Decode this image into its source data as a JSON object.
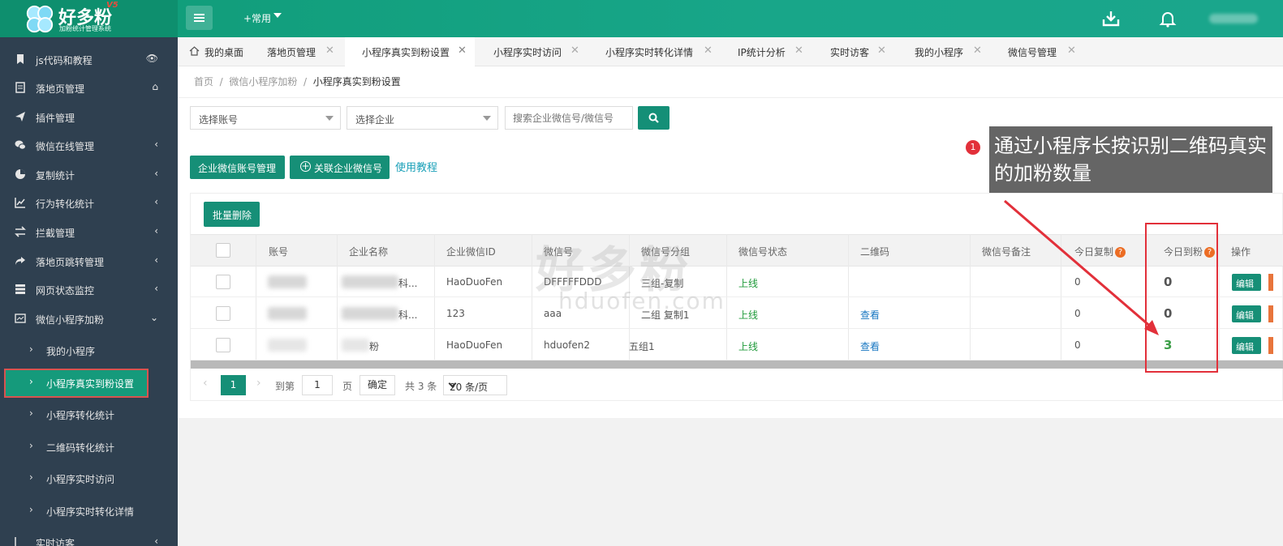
{
  "brand": {
    "name": "好多粉",
    "version": "V5",
    "subtitle": "加粉统计管理系统"
  },
  "topbar": {
    "common_label": "+常用"
  },
  "sidebar": {
    "items": [
      {
        "label": "js代码和教程",
        "icon": "bookmark-icon",
        "right": "👁"
      },
      {
        "label": "落地页管理",
        "icon": "file-icon",
        "right": "⌂"
      },
      {
        "label": "插件管理",
        "icon": "paper-plane-icon",
        "right": ""
      },
      {
        "label": "微信在线管理",
        "icon": "wechat-icon",
        "right": "‹"
      },
      {
        "label": "复制统计",
        "icon": "pie-chart-icon",
        "right": "‹"
      },
      {
        "label": "行为转化统计",
        "icon": "line-chart-icon",
        "right": "‹"
      },
      {
        "label": "拦截管理",
        "icon": "exchange-icon",
        "right": "‹"
      },
      {
        "label": "落地页跳转管理",
        "icon": "share-icon",
        "right": "‹"
      },
      {
        "label": "网页状态监控",
        "icon": "server-icon",
        "right": "‹"
      },
      {
        "label": "微信小程序加粉",
        "icon": "miniprogram-icon",
        "right": "⌄"
      }
    ],
    "sub_items": [
      {
        "label": "我的小程序"
      },
      {
        "label": "小程序真实到粉设置"
      },
      {
        "label": "小程序转化统计"
      },
      {
        "label": "二维码转化统计"
      },
      {
        "label": "小程序实时访问"
      },
      {
        "label": "小程序实时转化详情"
      }
    ],
    "partial_item": {
      "label": "实时访客"
    }
  },
  "tabs": [
    {
      "label": "我的桌面"
    },
    {
      "label": "落地页管理"
    },
    {
      "label": "小程序真实到粉设置"
    },
    {
      "label": "小程序实时访问"
    },
    {
      "label": "小程序实时转化详情"
    },
    {
      "label": "IP统计分析"
    },
    {
      "label": "实时访客"
    },
    {
      "label": "我的小程序"
    },
    {
      "label": "微信号管理"
    }
  ],
  "breadcrumb": {
    "home": "首页",
    "parent": "微信小程序加粉",
    "current": "小程序真实到粉设置",
    "sep": "/"
  },
  "filters": {
    "account_placeholder": "选择账号",
    "company_placeholder": "选择企业",
    "search_placeholder": "搜索企业微信号/微信号"
  },
  "actions": {
    "manage_label": "企业微信账号管理",
    "link_label": "关联企业微信号",
    "tutorial_label": "使用教程",
    "batch_delete_label": "批量删除"
  },
  "callout": {
    "number": "1",
    "text": "通过小程序长按识别二维码真实的加粉数量"
  },
  "table": {
    "headers": [
      "账号",
      "企业名称",
      "企业微信ID",
      "微信号",
      "微信号分组",
      "微信号状态",
      "二维码",
      "微信号备注",
      "今日复制",
      "今日到粉",
      "操作"
    ],
    "help_mark": "?",
    "rows": [
      {
        "account": "",
        "company": "科...",
        "corp_id": "HaoDuoFen",
        "wechat": "DFFFFFDDD",
        "group": "三组-复制",
        "status": "上线",
        "qr": "",
        "note": "",
        "copy": "0",
        "fans": "0"
      },
      {
        "account": "",
        "company": "科...",
        "corp_id": "123",
        "wechat": "aaa",
        "group": "二组 复制1",
        "status": "上线",
        "qr": "查看",
        "note": "",
        "copy": "0",
        "fans": "0"
      },
      {
        "account": "",
        "company": "粉",
        "corp_id": "HaoDuoFen",
        "wechat": "hduofen2",
        "group": "五组1",
        "status": "上线",
        "qr": "查看",
        "note": "",
        "copy": "0",
        "fans": "3"
      }
    ],
    "edit_label": "编辑"
  },
  "pager": {
    "current": "1",
    "goto_prefix": "到第",
    "goto_value": "1",
    "goto_suffix": "页",
    "confirm": "确定",
    "total": "共 3 条",
    "page_size": "20 条/页"
  },
  "watermark": {
    "text": "好多粉",
    "url": "hduofen.com"
  }
}
